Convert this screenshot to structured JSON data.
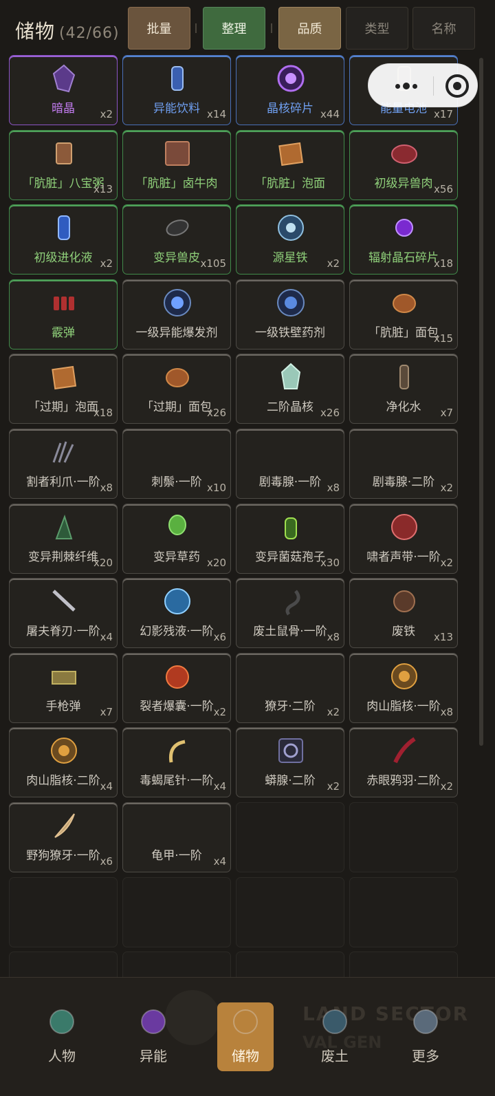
{
  "header": {
    "title": "储物",
    "count": "(42/66)",
    "buttons": {
      "batch": "批量",
      "sort": "整理",
      "quality": "品质",
      "type": "类型",
      "name": "名称"
    }
  },
  "colors": {
    "purple": "#8c55c6",
    "blue": "#4a70b8",
    "green": "#418a4a",
    "white": "#6b6761",
    "accent": "#b8823c"
  },
  "items": [
    {
      "name": "暗晶",
      "qty": "x2",
      "rarity": "purple",
      "icon": "dark-crystal-icon"
    },
    {
      "name": "异能饮料",
      "qty": "x14",
      "rarity": "blue",
      "icon": "energy-drink-icon"
    },
    {
      "name": "晶核碎片",
      "qty": "x44",
      "rarity": "blue",
      "icon": "crystal-core-fragment-icon"
    },
    {
      "name": "能量电池",
      "qty": "x17",
      "rarity": "blue",
      "icon": "energy-battery-icon"
    },
    {
      "name": "「肮脏」八宝粥",
      "qty": "x13",
      "rarity": "green",
      "icon": "canned-food-icon"
    },
    {
      "name": "「肮脏」卤牛肉",
      "qty": "",
      "rarity": "green",
      "icon": "beef-package-icon"
    },
    {
      "name": "「肮脏」泡面",
      "qty": "",
      "rarity": "green",
      "icon": "noodles-icon"
    },
    {
      "name": "初级异兽肉",
      "qty": "x56",
      "rarity": "green",
      "icon": "beast-meat-icon"
    },
    {
      "name": "初级进化液",
      "qty": "x2",
      "rarity": "green",
      "icon": "evolution-liquid-icon"
    },
    {
      "name": "变异兽皮",
      "qty": "x105",
      "rarity": "green",
      "icon": "beast-hide-icon"
    },
    {
      "name": "源星铁",
      "qty": "x2",
      "rarity": "green",
      "icon": "star-iron-icon"
    },
    {
      "name": "辐射晶石碎片",
      "qty": "x18",
      "rarity": "green",
      "icon": "radiation-crystal-icon"
    },
    {
      "name": "霰弹",
      "qty": "",
      "rarity": "green",
      "icon": "shotgun-shell-icon"
    },
    {
      "name": "一级异能爆发剂",
      "qty": "",
      "rarity": "white",
      "icon": "burst-potion-icon"
    },
    {
      "name": "一级铁壁药剂",
      "qty": "",
      "rarity": "white",
      "icon": "iron-wall-potion-icon"
    },
    {
      "name": "「肮脏」面包",
      "qty": "x15",
      "rarity": "white",
      "icon": "bread-icon"
    },
    {
      "name": "「过期」泡面",
      "qty": "x18",
      "rarity": "white",
      "icon": "noodles-icon"
    },
    {
      "name": "「过期」面包",
      "qty": "x26",
      "rarity": "white",
      "icon": "bread-icon"
    },
    {
      "name": "二阶晶核",
      "qty": "x26",
      "rarity": "white",
      "icon": "crystal-core-icon"
    },
    {
      "name": "净化水",
      "qty": "x7",
      "rarity": "white",
      "icon": "water-bottle-icon"
    },
    {
      "name": "割者利爪·一阶",
      "qty": "x8",
      "rarity": "white",
      "icon": "claw-icon"
    },
    {
      "name": "刺鬃·一阶",
      "qty": "x10",
      "rarity": "white",
      "icon": ""
    },
    {
      "name": "剧毒腺·一阶",
      "qty": "x8",
      "rarity": "white",
      "icon": ""
    },
    {
      "name": "剧毒腺·二阶",
      "qty": "x2",
      "rarity": "white",
      "icon": ""
    },
    {
      "name": "变异荆棘纤维",
      "qty": "x20",
      "rarity": "white",
      "icon": "thorn-fiber-icon"
    },
    {
      "name": "变异草药",
      "qty": "x20",
      "rarity": "white",
      "icon": "herb-icon"
    },
    {
      "name": "变异菌菇孢子",
      "qty": "x30",
      "rarity": "white",
      "icon": "spore-bottle-icon"
    },
    {
      "name": "啸者声带·一阶",
      "qty": "x2",
      "rarity": "white",
      "icon": "vocal-cord-icon"
    },
    {
      "name": "屠夫脊刃·一阶",
      "qty": "x4",
      "rarity": "white",
      "icon": "blade-icon"
    },
    {
      "name": "幻影残液·一阶",
      "qty": "x6",
      "rarity": "white",
      "icon": "phantom-liquid-icon"
    },
    {
      "name": "废土鼠骨·一阶",
      "qty": "x8",
      "rarity": "white",
      "icon": "rat-bone-icon"
    },
    {
      "name": "废铁",
      "qty": "x13",
      "rarity": "white",
      "icon": "scrap-iron-icon"
    },
    {
      "name": "手枪弹",
      "qty": "x7",
      "rarity": "white",
      "icon": "pistol-ammo-icon"
    },
    {
      "name": "裂者爆囊·一阶",
      "qty": "x2",
      "rarity": "white",
      "icon": "burst-sac-icon"
    },
    {
      "name": "獠牙·二阶",
      "qty": "x2",
      "rarity": "white",
      "icon": ""
    },
    {
      "name": "肉山脂核·一阶",
      "qty": "x8",
      "rarity": "white",
      "icon": "fat-core-icon"
    },
    {
      "name": "肉山脂核·二阶",
      "qty": "x4",
      "rarity": "white",
      "icon": "fat-core-icon"
    },
    {
      "name": "毒蝎尾针·一阶",
      "qty": "x4",
      "rarity": "white",
      "icon": "scorpion-stinger-icon"
    },
    {
      "name": "蟒腺·二阶",
      "qty": "x2",
      "rarity": "white",
      "icon": "python-gland-icon"
    },
    {
      "name": "赤眼鸦羽·二阶",
      "qty": "x2",
      "rarity": "white",
      "icon": "crow-feather-icon"
    },
    {
      "name": "野狗獠牙·一阶",
      "qty": "x6",
      "rarity": "white",
      "icon": "dog-fang-icon"
    },
    {
      "name": "龟甲·一阶",
      "qty": "x4",
      "rarity": "white",
      "icon": ""
    }
  ],
  "nav": [
    {
      "label": "人物",
      "icon": "character-icon"
    },
    {
      "label": "异能",
      "icon": "power-icon"
    },
    {
      "label": "储物",
      "icon": "backpack-icon",
      "active": true
    },
    {
      "label": "废土",
      "icon": "wasteland-icon"
    },
    {
      "label": "更多",
      "icon": "more-icon"
    }
  ],
  "nav_bg": {
    "line1": "LAND SECTOR",
    "line2": "VAL GEN"
  }
}
